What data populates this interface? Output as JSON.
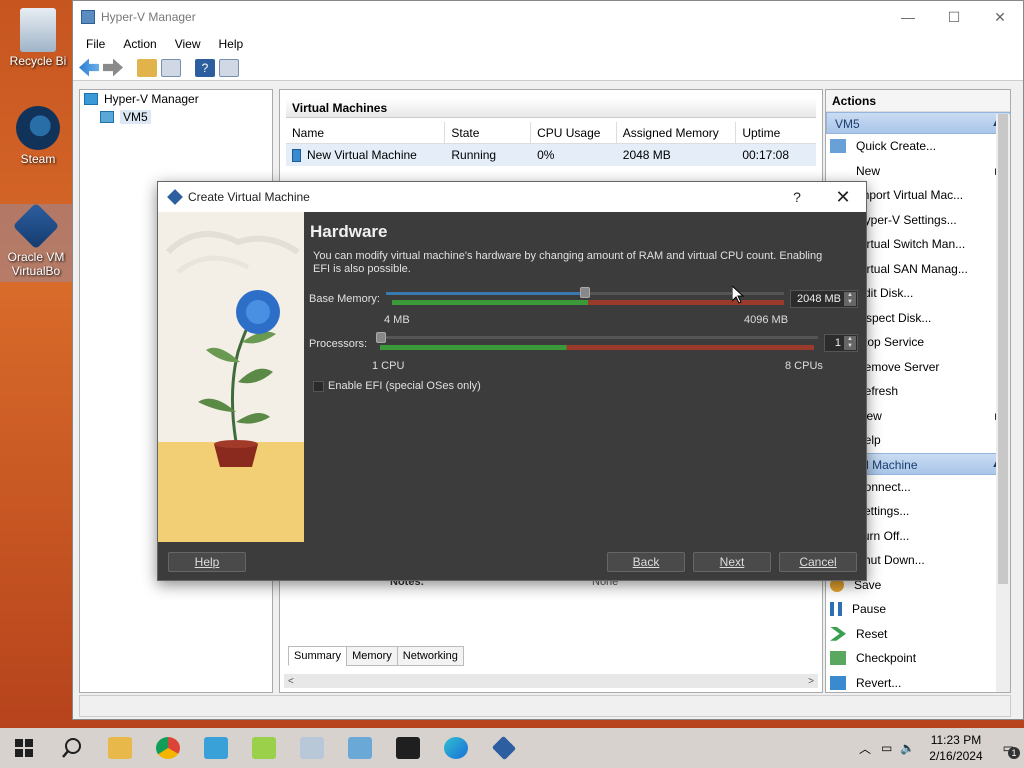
{
  "desktop": {
    "icons": [
      {
        "label": "Recycle Bi",
        "icon": "recycle-bin-icon"
      },
      {
        "label": "Steam",
        "icon": "steam-icon"
      },
      {
        "label": "Oracle VM VirtualBo",
        "icon": "virtualbox-icon"
      }
    ]
  },
  "hyperv": {
    "title": "Hyper-V Manager",
    "menu": [
      "File",
      "Action",
      "View",
      "Help"
    ],
    "tree": {
      "root": "Hyper-V Manager",
      "host": "VM5"
    },
    "vm_section_title": "Virtual Machines",
    "columns": [
      "Name",
      "State",
      "CPU Usage",
      "Assigned Memory",
      "Uptime"
    ],
    "rows": [
      {
        "name": "New Virtual Machine",
        "state": "Running",
        "cpu": "0%",
        "memory": "2048 MB",
        "uptime": "00:17:08"
      }
    ],
    "details_label": "Notes:",
    "details_value": "None",
    "tabs": [
      "Summary",
      "Memory",
      "Networking"
    ],
    "actions": {
      "title": "Actions",
      "host_section": "VM5",
      "host_items": [
        "Quick Create...",
        "New",
        "Import Virtual Mac...",
        "Hyper-V Settings...",
        "Virtual Switch Man...",
        "Virtual SAN Manag...",
        "Edit Disk...",
        "Inspect Disk...",
        "Stop Service",
        "Remove Server",
        "Refresh",
        "View",
        "Help"
      ],
      "vm_section": "Virtual Machine",
      "vm_items": [
        "Connect...",
        "Settings...",
        "Turn Off...",
        "Shut Down...",
        "Save",
        "Pause",
        "Reset",
        "Checkpoint",
        "Revert..."
      ]
    }
  },
  "dialog": {
    "title": "Create Virtual Machine",
    "help_glyph": "?",
    "close_glyph": "✕",
    "heading": "Hardware",
    "description": "You can modify virtual machine's hardware by changing amount of RAM and virtual CPU count. Enabling EFI is also possible.",
    "memory": {
      "label": "Base Memory:",
      "value": "2048 MB",
      "min_label": "4 MB",
      "max_label": "4096 MB",
      "fraction": 0.5
    },
    "processors": {
      "label": "Processors:",
      "value": "1",
      "min_label": "1 CPU",
      "max_label": "8 CPUs",
      "fraction": 0.0
    },
    "efi": {
      "label": "Enable EFI (special OSes only)",
      "checked": false
    },
    "buttons": {
      "help": "Help",
      "back": "Back",
      "next": "Next",
      "cancel": "Cancel"
    }
  },
  "taskbar": {
    "time": "11:23 PM",
    "date": "2/16/2024",
    "notifications": "1"
  },
  "colors": {
    "desktop": "#c65520",
    "dialog_bg": "#3c3c3c",
    "slider_green": "#3a9a3a",
    "slider_red": "#9a3a2a",
    "slider_blue": "#3a78b0",
    "selection": "#e5eef8"
  }
}
